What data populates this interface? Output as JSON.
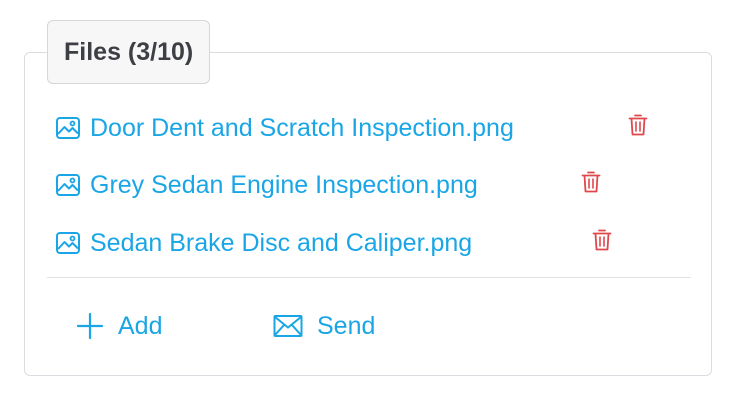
{
  "panel": {
    "title": "Files (3/10)"
  },
  "files": [
    {
      "name": "Door Dent and Scratch Inspection.png",
      "icon": "image-icon",
      "action_icon": "trash-icon"
    },
    {
      "name": "Grey Sedan Engine Inspection.png",
      "icon": "image-icon",
      "action_icon": "trash-icon"
    },
    {
      "name": "Sedan Brake Disc and Caliper.png",
      "icon": "image-icon",
      "action_icon": "trash-icon"
    }
  ],
  "actions": {
    "add_label": "Add",
    "send_label": "Send"
  },
  "colors": {
    "link": "#1aa6e6",
    "danger": "#e0474c",
    "border": "#d9dde2",
    "legend_bg": "#f7f7f8",
    "title_text": "#3d3f44"
  }
}
